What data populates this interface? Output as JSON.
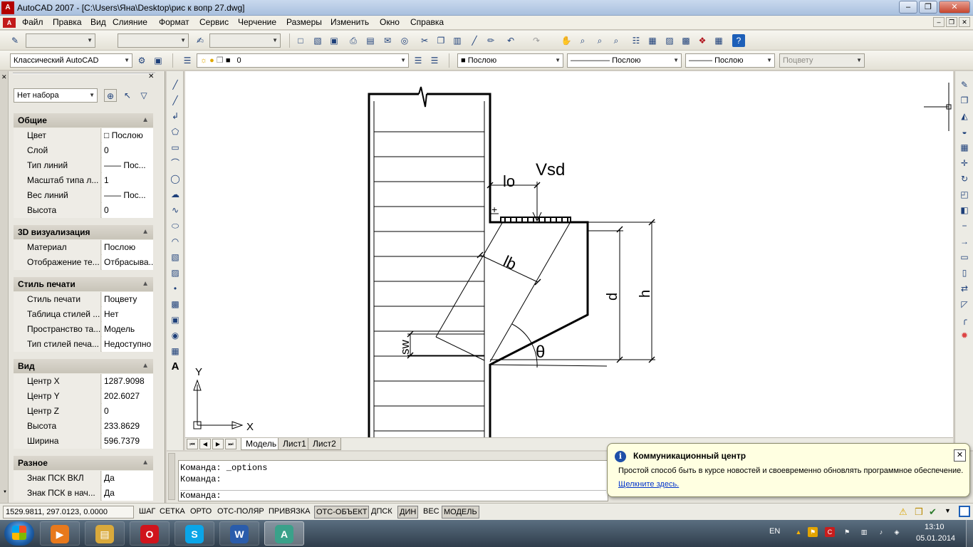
{
  "window": {
    "title": "AutoCAD 2007 - [C:\\Users\\Яна\\Desktop\\рис к вопр 27.dwg]",
    "logo_text": "A",
    "min": "–",
    "restore": "❐",
    "close": "✕"
  },
  "menu": {
    "items": [
      "Файл",
      "Правка",
      "Вид",
      "Слияние",
      "Формат",
      "Сервис",
      "Черчение",
      "Размеры",
      "Изменить",
      "Окно",
      "Справка"
    ],
    "mdi_min": "–",
    "mdi_restore": "❐",
    "mdi_close": "✕"
  },
  "toolbar_top": {
    "icons": [
      "spell-check-icon",
      "new-file-icon",
      "open-file-icon",
      "save-icon",
      "print-icon",
      "preview-icon",
      "publish-icon",
      "cut-icon",
      "copy-icon",
      "paste-icon",
      "match-properties-icon",
      "brush-icon",
      "undo-icon",
      "redo-icon",
      "pan-icon",
      "zoom-realtime-icon",
      "zoom-window-icon",
      "zoom-previous-icon",
      "properties-icon",
      "design-center-icon",
      "tool-palettes-icon",
      "sheet-set-icon",
      "markup-icon",
      "calculator-icon",
      "help-icon"
    ]
  },
  "toolbar_layers": {
    "workspace": "Классический AutoCAD",
    "layer": "0",
    "color": "Послою",
    "linetype": "Послою",
    "lineweight": "Послою",
    "plotstyle": "Поцвету"
  },
  "properties": {
    "selection": "Нет набора",
    "sections": [
      {
        "title": "Общие",
        "rows": [
          {
            "k": "Цвет",
            "v": "□ Послою"
          },
          {
            "k": "Слой",
            "v": "0"
          },
          {
            "k": "Тип линий",
            "v": "—— Пос..."
          },
          {
            "k": "Масштаб типа л...",
            "v": "1"
          },
          {
            "k": "Вес линий",
            "v": "—— Пос..."
          },
          {
            "k": "Высота",
            "v": "0"
          }
        ]
      },
      {
        "title": "3D визуализация",
        "rows": [
          {
            "k": "Материал",
            "v": "Послою"
          },
          {
            "k": "Отображение те...",
            "v": "Отбрасыва..."
          }
        ]
      },
      {
        "title": "Стиль печати",
        "rows": [
          {
            "k": "Стиль печати",
            "v": "Поцвету"
          },
          {
            "k": "Таблица стилей ...",
            "v": "Нет"
          },
          {
            "k": "Пространство та...",
            "v": "Модель"
          },
          {
            "k": "Тип стилей печа...",
            "v": "Недоступно"
          }
        ]
      },
      {
        "title": "Вид",
        "rows": [
          {
            "k": "Центр X",
            "v": "1287.9098"
          },
          {
            "k": "Центр Y",
            "v": "202.6027"
          },
          {
            "k": "Центр Z",
            "v": "0"
          },
          {
            "k": "Высота",
            "v": "233.8629"
          },
          {
            "k": "Ширина",
            "v": "596.7379"
          }
        ]
      },
      {
        "title": "Разное",
        "rows": [
          {
            "k": "Знак ПСК ВКЛ",
            "v": "Да"
          },
          {
            "k": "Знак ПСК в нач...",
            "v": "Да"
          }
        ]
      }
    ]
  },
  "drawing": {
    "labels": {
      "lo": "lo",
      "vsd": "Vsd",
      "lb": "lb",
      "d": "d",
      "h": "h",
      "sw": "sw",
      "theta": "θ",
      "ucs_x": "X",
      "ucs_y": "Y",
      "plus": "+"
    }
  },
  "tabs": [
    "Модель",
    "Лист1",
    "Лист2"
  ],
  "command": {
    "lines": [
      "Команда:  _options",
      "Команда:",
      "Команда:"
    ]
  },
  "status": {
    "coords": "1529.9811, 297.0123, 0.0000",
    "buttons": [
      {
        "label": "ШАГ",
        "on": false
      },
      {
        "label": "СЕТКА",
        "on": false
      },
      {
        "label": "ОРТО",
        "on": false
      },
      {
        "label": "ОТС-ПОЛЯР",
        "on": false
      },
      {
        "label": "ПРИВЯЗКА",
        "on": false
      },
      {
        "label": "ОТС-ОБЪЕКТ",
        "on": true
      },
      {
        "label": "ДПСК",
        "on": false
      },
      {
        "label": "ДИН",
        "on": true
      },
      {
        "label": "ВЕС",
        "on": false
      },
      {
        "label": "МОДЕЛЬ",
        "on": true
      }
    ]
  },
  "balloon": {
    "title": "Коммуникационный центр",
    "message": "Простой способ быть в курсе новостей и своевременно обновлять программное обеспечение.",
    "link": "Щелкните здесь."
  },
  "taskbar": {
    "apps": [
      {
        "name": "media-player",
        "glyph": "▶",
        "color": "#e8791c"
      },
      {
        "name": "explorer",
        "glyph": "▤",
        "color": "#d9a93b"
      },
      {
        "name": "opera",
        "glyph": "O",
        "color": "#d0141c"
      },
      {
        "name": "skype",
        "glyph": "S",
        "color": "#0aa5e8"
      },
      {
        "name": "word",
        "glyph": "W",
        "color": "#2a5cab"
      },
      {
        "name": "autocad",
        "glyph": "A",
        "color": "#3aa18a"
      }
    ],
    "lang": "EN",
    "time": "13:10",
    "date": "05.01.2014"
  },
  "colors": {
    "accent": "#1d3f79",
    "balloon_bg": "#ffffe1",
    "link": "#0033cc"
  }
}
